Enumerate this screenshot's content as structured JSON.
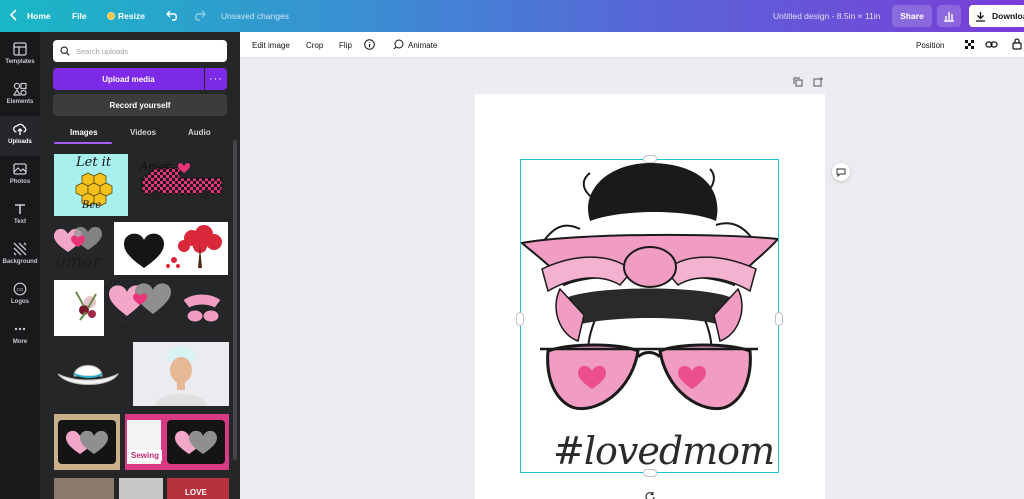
{
  "topbar": {
    "home": "Home",
    "file": "File",
    "resize": "Resize",
    "status": "Unsaved changes",
    "doc_title": "Untitled design - 8.5in × 11in",
    "share": "Share",
    "download": "Downloa"
  },
  "rail": {
    "items": [
      {
        "label": "Templates",
        "icon": "templates-icon"
      },
      {
        "label": "Elements",
        "icon": "elements-icon"
      },
      {
        "label": "Uploads",
        "icon": "uploads-icon"
      },
      {
        "label": "Photos",
        "icon": "photos-icon"
      },
      {
        "label": "Text",
        "icon": "text-icon"
      },
      {
        "label": "Background",
        "icon": "background-icon"
      },
      {
        "label": "Logos",
        "icon": "logos-icon"
      },
      {
        "label": "More",
        "icon": "more-icon"
      }
    ]
  },
  "panel": {
    "search_placeholder": "Search uploads",
    "upload_media": "Upload media",
    "record": "Record yourself",
    "tabs": [
      "Images",
      "Videos",
      "Audio"
    ],
    "thumb_text": {
      "let_it_bee_1": "Let it",
      "let_it_bee_2": "Bee",
      "amor_truck": "Amor",
      "amor": "amor",
      "sewing": "Sewing",
      "love": "LOVE"
    }
  },
  "context_toolbar": {
    "edit_image": "Edit image",
    "crop": "Crop",
    "flip": "Flip",
    "animate": "Animate",
    "position": "Position"
  },
  "design": {
    "text": "#lovedmom"
  },
  "colors": {
    "accent": "#7d2ae8",
    "selection": "#20c4cb",
    "rail_bg": "#18191b",
    "panel_bg": "#252627",
    "pink": "#f19cc3"
  }
}
